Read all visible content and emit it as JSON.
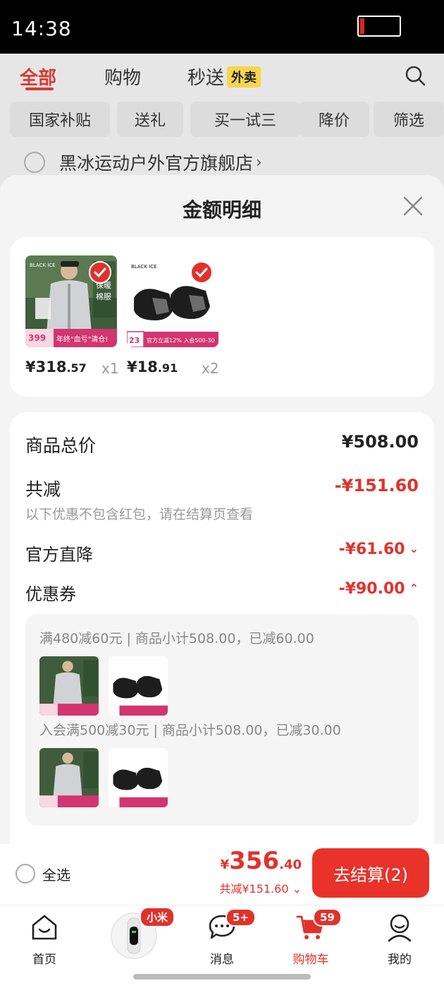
{
  "status_bar": {
    "time": "14:38"
  },
  "top_tabs": [
    {
      "label": "全部",
      "active": true
    },
    {
      "label": "购物",
      "active": false
    },
    {
      "label": "秒送",
      "active": false,
      "tag": "外卖"
    }
  ],
  "filter_chips": [
    "国家补贴",
    "送礼",
    "买一试三",
    "降价",
    "筛选"
  ],
  "store": {
    "name": "黑冰运动户外官方旗舰店",
    "arrow": "›"
  },
  "sheet": {
    "title": "金额明细",
    "products": [
      {
        "name": "jacket",
        "price_int": "¥318",
        "price_dec": ".57",
        "qty": "x1",
        "promo_price": "399",
        "promo_text": "年终\"血亏\"清仓!",
        "badge_text": "男士保暖棉服",
        "brand": "BLACK ICE"
      },
      {
        "name": "socks",
        "price_int": "¥18",
        "price_dec": ".91",
        "qty": "x2",
        "promo_price": "23",
        "promo_text": "官方立减12% 入会500-30",
        "brand": "BLACK ICE"
      }
    ],
    "summary": {
      "total_label": "商品总价",
      "total_value": "¥508.00",
      "reduce_label": "共减",
      "reduce_value": "-¥151.60",
      "note": "以下优惠不包含红包，请在结算页查看",
      "direct_label": "官方直降",
      "direct_value": "-¥61.60",
      "coupon_label": "优惠券",
      "coupon_value": "-¥90.00"
    },
    "coupons": [
      {
        "text": "满480减60元 | 商品小计508.00，已减60.00"
      },
      {
        "text": "入会满500减30元 | 商品小计508.00，已减30.00"
      }
    ]
  },
  "checkout": {
    "select_all": "全选",
    "currency": "¥",
    "total_int": "356",
    "total_dec": ".40",
    "saved": "共减¥151.60",
    "button": "去结算(2)"
  },
  "nav": [
    {
      "label": "首页",
      "icon": "home-icon"
    },
    {
      "label": "",
      "icon": "smart-band-icon",
      "badge": "小米"
    },
    {
      "label": "消息",
      "icon": "message-icon",
      "badge": "5+"
    },
    {
      "label": "购物车",
      "icon": "cart-icon",
      "badge": "59",
      "active": true
    },
    {
      "label": "我的",
      "icon": "user-icon"
    }
  ],
  "colors": {
    "accent": "#e0322b",
    "tag_yellow": "#f7d54a"
  }
}
